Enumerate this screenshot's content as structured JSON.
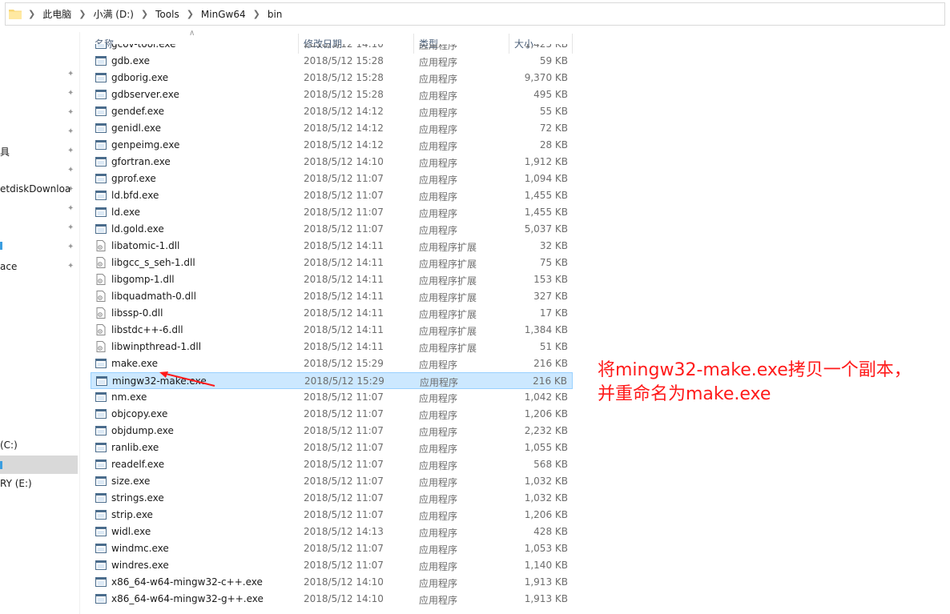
{
  "breadcrumb": [
    "此电脑",
    "小满 (D:)",
    "Tools",
    "MinGw64",
    "bin"
  ],
  "nav": {
    "items": [
      {
        "label": "具"
      },
      {
        "label": "etdiskDownloa"
      },
      {
        "label": "ace"
      },
      {
        "label": "(C:)"
      },
      {
        "label": "RY (E:)"
      }
    ]
  },
  "columns": {
    "name": "名称",
    "date": "修改日期",
    "type": "类型",
    "size": "大小"
  },
  "files": [
    {
      "name": "gcov-tool.exe",
      "date": "2018/5/12 14:10",
      "type": "应用程序",
      "size": "1,425 KB",
      "icon": "exe"
    },
    {
      "name": "gdb.exe",
      "date": "2018/5/12 15:28",
      "type": "应用程序",
      "size": "59 KB",
      "icon": "exe"
    },
    {
      "name": "gdborig.exe",
      "date": "2018/5/12 15:28",
      "type": "应用程序",
      "size": "9,370 KB",
      "icon": "exe"
    },
    {
      "name": "gdbserver.exe",
      "date": "2018/5/12 15:28",
      "type": "应用程序",
      "size": "495 KB",
      "icon": "exe"
    },
    {
      "name": "gendef.exe",
      "date": "2018/5/12 14:12",
      "type": "应用程序",
      "size": "55 KB",
      "icon": "exe"
    },
    {
      "name": "genidl.exe",
      "date": "2018/5/12 14:12",
      "type": "应用程序",
      "size": "72 KB",
      "icon": "exe"
    },
    {
      "name": "genpeimg.exe",
      "date": "2018/5/12 14:12",
      "type": "应用程序",
      "size": "28 KB",
      "icon": "exe"
    },
    {
      "name": "gfortran.exe",
      "date": "2018/5/12 14:10",
      "type": "应用程序",
      "size": "1,912 KB",
      "icon": "exe"
    },
    {
      "name": "gprof.exe",
      "date": "2018/5/12 11:07",
      "type": "应用程序",
      "size": "1,094 KB",
      "icon": "exe"
    },
    {
      "name": "ld.bfd.exe",
      "date": "2018/5/12 11:07",
      "type": "应用程序",
      "size": "1,455 KB",
      "icon": "exe"
    },
    {
      "name": "ld.exe",
      "date": "2018/5/12 11:07",
      "type": "应用程序",
      "size": "1,455 KB",
      "icon": "exe"
    },
    {
      "name": "ld.gold.exe",
      "date": "2018/5/12 11:07",
      "type": "应用程序",
      "size": "5,037 KB",
      "icon": "exe"
    },
    {
      "name": "libatomic-1.dll",
      "date": "2018/5/12 14:11",
      "type": "应用程序扩展",
      "size": "32 KB",
      "icon": "dll"
    },
    {
      "name": "libgcc_s_seh-1.dll",
      "date": "2018/5/12 14:11",
      "type": "应用程序扩展",
      "size": "75 KB",
      "icon": "dll"
    },
    {
      "name": "libgomp-1.dll",
      "date": "2018/5/12 14:11",
      "type": "应用程序扩展",
      "size": "153 KB",
      "icon": "dll"
    },
    {
      "name": "libquadmath-0.dll",
      "date": "2018/5/12 14:11",
      "type": "应用程序扩展",
      "size": "327 KB",
      "icon": "dll"
    },
    {
      "name": "libssp-0.dll",
      "date": "2018/5/12 14:11",
      "type": "应用程序扩展",
      "size": "17 KB",
      "icon": "dll"
    },
    {
      "name": "libstdc++-6.dll",
      "date": "2018/5/12 14:11",
      "type": "应用程序扩展",
      "size": "1,384 KB",
      "icon": "dll"
    },
    {
      "name": "libwinpthread-1.dll",
      "date": "2018/5/12 14:11",
      "type": "应用程序扩展",
      "size": "51 KB",
      "icon": "dll"
    },
    {
      "name": "make.exe",
      "date": "2018/5/12 15:29",
      "type": "应用程序",
      "size": "216 KB",
      "icon": "exe"
    },
    {
      "name": "mingw32-make.exe",
      "date": "2018/5/12 15:29",
      "type": "应用程序",
      "size": "216 KB",
      "icon": "exe",
      "selected": true
    },
    {
      "name": "nm.exe",
      "date": "2018/5/12 11:07",
      "type": "应用程序",
      "size": "1,042 KB",
      "icon": "exe"
    },
    {
      "name": "objcopy.exe",
      "date": "2018/5/12 11:07",
      "type": "应用程序",
      "size": "1,206 KB",
      "icon": "exe"
    },
    {
      "name": "objdump.exe",
      "date": "2018/5/12 11:07",
      "type": "应用程序",
      "size": "2,232 KB",
      "icon": "exe"
    },
    {
      "name": "ranlib.exe",
      "date": "2018/5/12 11:07",
      "type": "应用程序",
      "size": "1,055 KB",
      "icon": "exe"
    },
    {
      "name": "readelf.exe",
      "date": "2018/5/12 11:07",
      "type": "应用程序",
      "size": "568 KB",
      "icon": "exe"
    },
    {
      "name": "size.exe",
      "date": "2018/5/12 11:07",
      "type": "应用程序",
      "size": "1,032 KB",
      "icon": "exe"
    },
    {
      "name": "strings.exe",
      "date": "2018/5/12 11:07",
      "type": "应用程序",
      "size": "1,032 KB",
      "icon": "exe"
    },
    {
      "name": "strip.exe",
      "date": "2018/5/12 11:07",
      "type": "应用程序",
      "size": "1,206 KB",
      "icon": "exe"
    },
    {
      "name": "widl.exe",
      "date": "2018/5/12 14:13",
      "type": "应用程序",
      "size": "428 KB",
      "icon": "exe"
    },
    {
      "name": "windmc.exe",
      "date": "2018/5/12 11:07",
      "type": "应用程序",
      "size": "1,053 KB",
      "icon": "exe"
    },
    {
      "name": "windres.exe",
      "date": "2018/5/12 11:07",
      "type": "应用程序",
      "size": "1,140 KB",
      "icon": "exe"
    },
    {
      "name": "x86_64-w64-mingw32-c++.exe",
      "date": "2018/5/12 14:10",
      "type": "应用程序",
      "size": "1,913 KB",
      "icon": "exe"
    },
    {
      "name": "x86_64-w64-mingw32-g++.exe",
      "date": "2018/5/12 14:10",
      "type": "应用程序",
      "size": "1,913 KB",
      "icon": "exe"
    }
  ],
  "annotation": {
    "line1": "将mingw32-make.exe拷贝一个副本，",
    "line2": "并重命名为make.exe",
    "color": "#ff1a1a"
  },
  "colors": {
    "selection_bg": "#cce8ff",
    "selection_border": "#99d1ff",
    "header_text": "#4c607a"
  }
}
